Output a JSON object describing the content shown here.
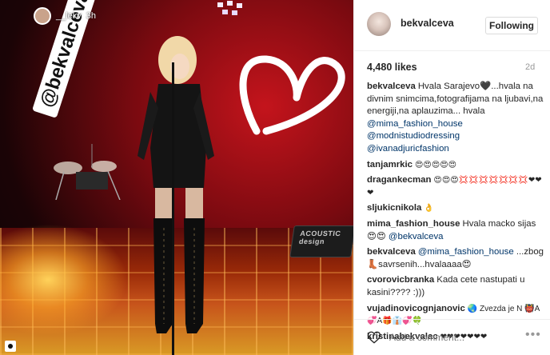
{
  "story": {
    "username": "__lekv",
    "time": "3h",
    "tag": "@bekvalceva"
  },
  "speaker_brand": "ACOUSTIC design",
  "header": {
    "username": "bekvalceva",
    "follow_label": "Following"
  },
  "stats": {
    "likes": "4,480 likes",
    "age": "2d"
  },
  "caption": {
    "user": "bekvalceva",
    "text": "Hvala Sarajevo🖤...hvala na divnim snimcima,fotografijama na ljubavi,na energiji,na aplauzima... hvala",
    "mentions": [
      "@mima_fashion_house",
      "@modnistudiodressing",
      "@ivanadjuricfashion"
    ]
  },
  "comments": [
    {
      "user": "tanjamrkic",
      "text": "😍😍😍😍😍"
    },
    {
      "user": "dragankecman",
      "text": "😍😍😍💢💢💢💢💢💢💢❤❤❤"
    },
    {
      "user": "sljukicnikola",
      "text": "👌"
    },
    {
      "user": "mima_fashion_house",
      "text": "Hvala macko sijas 😍😍 ",
      "mention": "@bekvalceva"
    },
    {
      "user": "bekvalceva",
      "text": " ...zbog👢savrsenih...hvalaaaa😍",
      "mention": "@mima_fashion_house"
    },
    {
      "user": "cvorovicbranka",
      "text": "Kada cete nastupati u kasini???? :)))"
    },
    {
      "user": "vujadinovicognjanovic",
      "text": "🌏 Zvezda je N 👹A💞A🎁👔💞🍀"
    },
    {
      "user": "kristinabekvalac",
      "text": "❤❤❤❤❤❤❤"
    }
  ],
  "add_comment_placeholder": "Add a comment...",
  "more_label": "•••",
  "colors": {
    "link": "#003569",
    "border": "#efefef",
    "muted": "#999999"
  }
}
